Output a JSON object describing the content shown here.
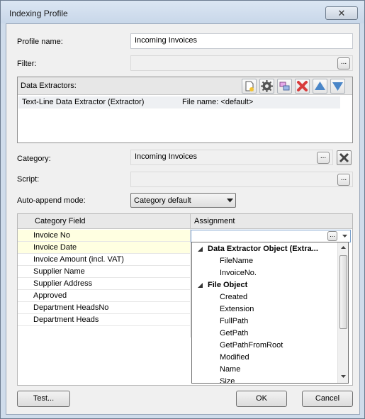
{
  "window": {
    "title": "Indexing Profile",
    "close_glyph": "✕"
  },
  "profile": {
    "label": "Profile name:",
    "value": "Incoming Invoices"
  },
  "filter": {
    "label": "Filter:",
    "value": "",
    "button": "..."
  },
  "extractors": {
    "label": "Data Extractors:",
    "toolbar_icons": [
      "new-icon",
      "settings-icon",
      "copy-icon",
      "delete-icon",
      "move-up-icon",
      "move-down-icon"
    ],
    "items": [
      {
        "name": "Text-Line Data Extractor (Extractor)",
        "detail": "File name: <default>"
      }
    ]
  },
  "category": {
    "label": "Category:",
    "value": "Incoming Invoices",
    "button": "..."
  },
  "script": {
    "label": "Script:",
    "value": "",
    "button": "..."
  },
  "auto_append": {
    "label": "Auto-append mode:",
    "selected": "Category default"
  },
  "table": {
    "headers": [
      "Category Field",
      "Assignment"
    ],
    "rows": [
      "Invoice No",
      "Invoice Date",
      "Invoice Amount (incl. VAT)",
      "Supplier Name",
      "Supplier Address",
      "Approved",
      "Department HeadsNo",
      "Department Heads"
    ],
    "cell_button": "..."
  },
  "dropdown": {
    "groups": [
      {
        "name": "Data Extractor Object (Extra...",
        "children": [
          "FileName",
          "InvoiceNo."
        ]
      },
      {
        "name": "File Object",
        "children": [
          "Created",
          "Extension",
          "FullPath",
          "GetPath",
          "GetPathFromRoot",
          "Modified",
          "Name",
          "Size"
        ]
      }
    ]
  },
  "buttons": {
    "test": "Test...",
    "ok": "OK",
    "cancel": "Cancel"
  },
  "colors": {
    "highlight_row": "#ffffe1",
    "delete_red": "#d83b3b",
    "arrow_blue": "#4a86c8"
  }
}
